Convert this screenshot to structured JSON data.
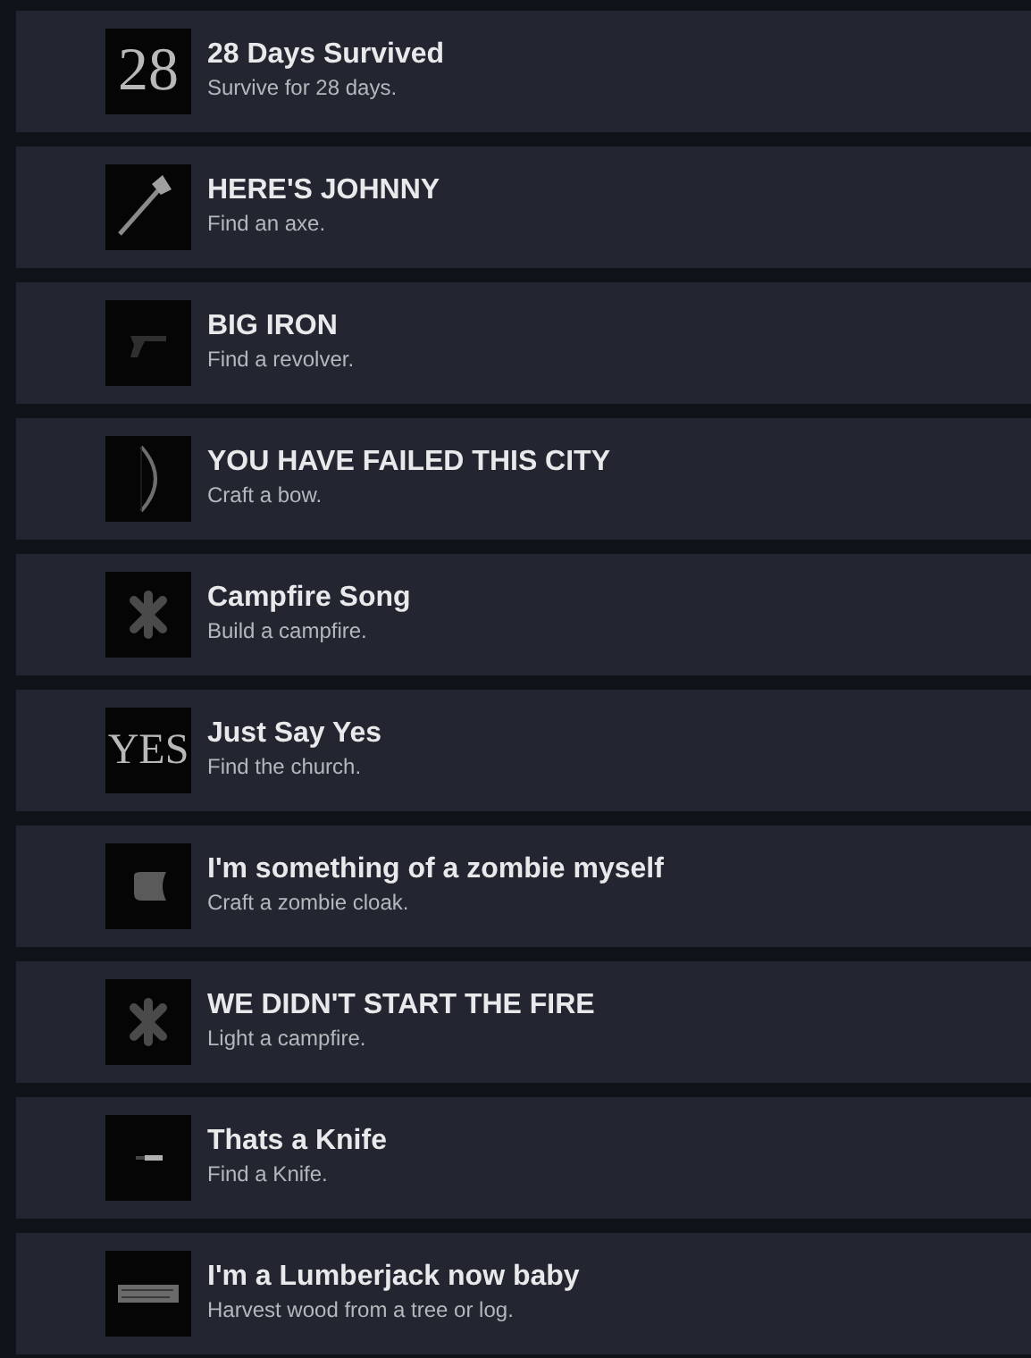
{
  "achievements": [
    {
      "title": "28 Days Survived",
      "description": "Survive for 28 days.",
      "icon": {
        "kind": "text",
        "text": "28"
      }
    },
    {
      "title": "HERE'S JOHNNY",
      "description": "Find an axe.",
      "icon": {
        "kind": "axe"
      }
    },
    {
      "title": "BIG IRON",
      "description": "Find a revolver.",
      "icon": {
        "kind": "revolver"
      }
    },
    {
      "title": "YOU HAVE FAILED THIS CITY",
      "description": "Craft a bow.",
      "icon": {
        "kind": "bow"
      }
    },
    {
      "title": "Campfire Song",
      "description": "Build a campfire.",
      "icon": {
        "kind": "campfire"
      }
    },
    {
      "title": "Just Say Yes",
      "description": "Find the church.",
      "icon": {
        "kind": "text",
        "text": "YES"
      }
    },
    {
      "title": "I'm something of a zombie myself",
      "description": "Craft a zombie cloak.",
      "icon": {
        "kind": "cloak"
      }
    },
    {
      "title": "WE DIDN'T START THE FIRE",
      "description": "Light a campfire.",
      "icon": {
        "kind": "campfire"
      }
    },
    {
      "title": "Thats a Knife",
      "description": "Find a Knife.",
      "icon": {
        "kind": "knife"
      }
    },
    {
      "title": "I'm a Lumberjack now baby",
      "description": "Harvest wood from a tree or log.",
      "icon": {
        "kind": "log"
      }
    }
  ]
}
